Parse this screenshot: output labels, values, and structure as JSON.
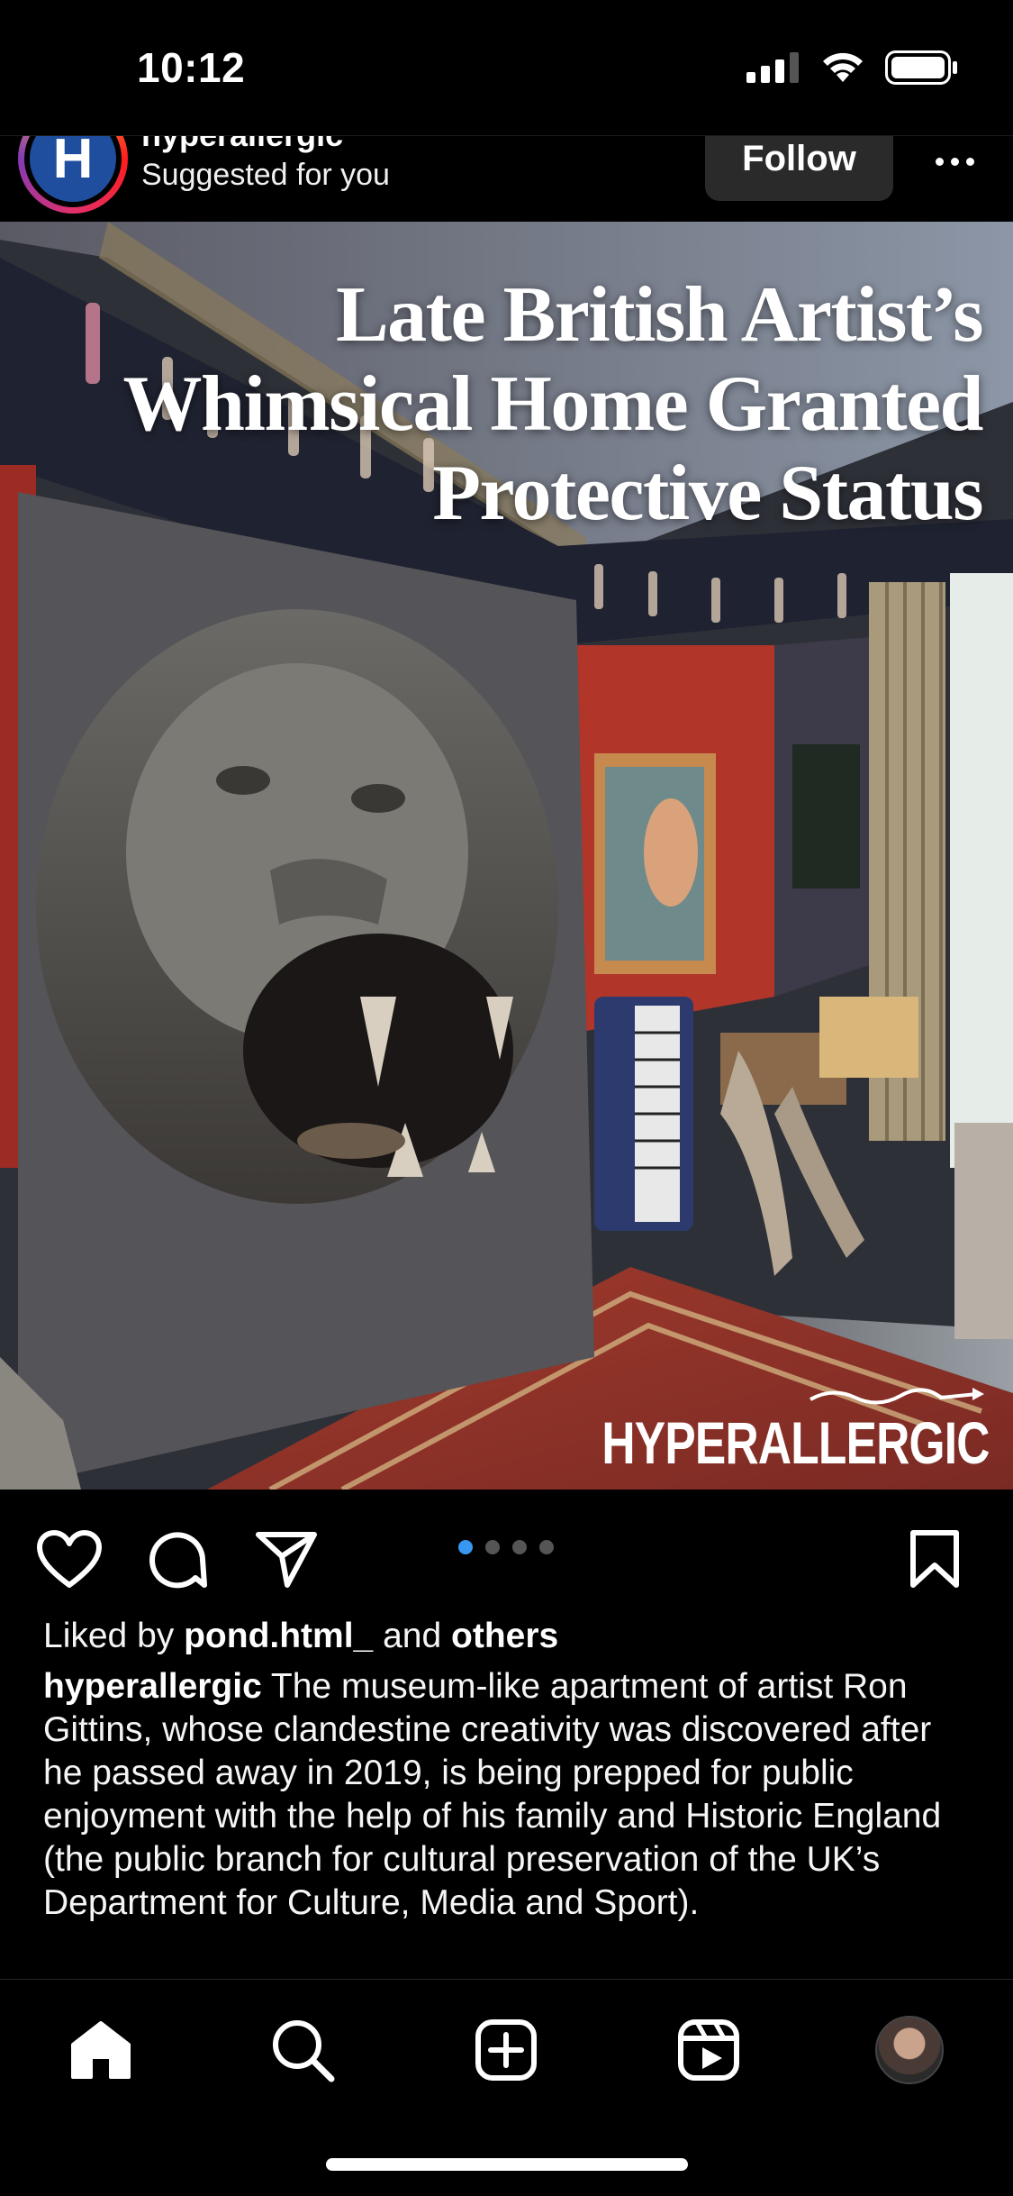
{
  "status_bar": {
    "time": "10:12"
  },
  "post": {
    "account": {
      "username": "hyperallergic",
      "avatar_letter": "H",
      "subtitle": "Suggested for you"
    },
    "follow_label": "Follow",
    "image": {
      "headline_lines": [
        "Late British Artist’s",
        "Whimsical Home Granted",
        "Protective Status"
      ],
      "wordmark": "HYPERALLERGIC"
    },
    "carousel": {
      "total": 4,
      "active_index": 0
    },
    "likes": {
      "prefix": "Liked by",
      "user": "pond.html_",
      "joiner": "and",
      "others": "others"
    },
    "caption": {
      "username": "hyperallergic",
      "text": "The museum-like apartment of artist Ron Gittins, whose clandestine creativity was discovered after he passed away in 2019, is being prepped for public enjoyment with the help of his family and Historic England (the public branch for cultural preservation of the UK’s Department for Culture, Media and Sport)."
    }
  },
  "bottom_nav": [
    "home-icon",
    "search-icon",
    "create-icon",
    "reels-icon",
    "profile-avatar"
  ],
  "colors": {
    "accent": "#3897f0",
    "background": "#000000"
  }
}
